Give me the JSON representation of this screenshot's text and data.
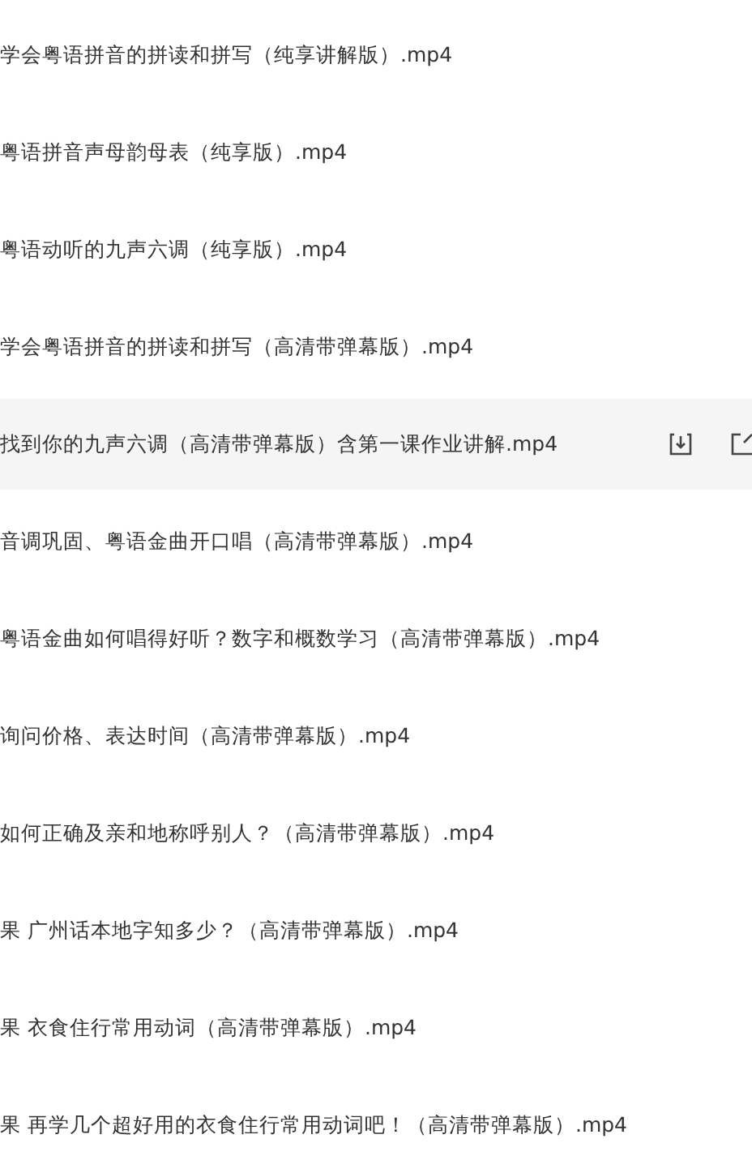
{
  "files": [
    {
      "name": "学会粤语拼音的拼读和拼写（纯享讲解版）.mp4",
      "selected": false
    },
    {
      "name": "粤语拼音声母韵母表（纯享版）.mp4",
      "selected": false
    },
    {
      "name": "粤语动听的九声六调（纯享版）.mp4",
      "selected": false
    },
    {
      "name": "学会粤语拼音的拼读和拼写（高清带弹幕版）.mp4",
      "selected": false
    },
    {
      "name": "找到你的九声六调（高清带弹幕版）含第一课作业讲解.mp4",
      "selected": true
    },
    {
      "name": "音调巩固、粤语金曲开口唱（高清带弹幕版）.mp4",
      "selected": false
    },
    {
      "name": "粤语金曲如何唱得好听？数字和概数学习（高清带弹幕版）.mp4",
      "selected": false
    },
    {
      "name": "询问价格、表达时间（高清带弹幕版）.mp4",
      "selected": false
    },
    {
      "name": "如何正确及亲和地称呼别人？（高清带弹幕版）.mp4",
      "selected": false
    },
    {
      "name": "果 广州话本地字知多少？（高清带弹幕版）.mp4",
      "selected": false
    },
    {
      "name": "果 衣食住行常用动词（高清带弹幕版）.mp4",
      "selected": false
    },
    {
      "name": "果 再学几个超好用的衣食住行常用动词吧！（高清带弹幕版）.mp4",
      "selected": false
    }
  ]
}
